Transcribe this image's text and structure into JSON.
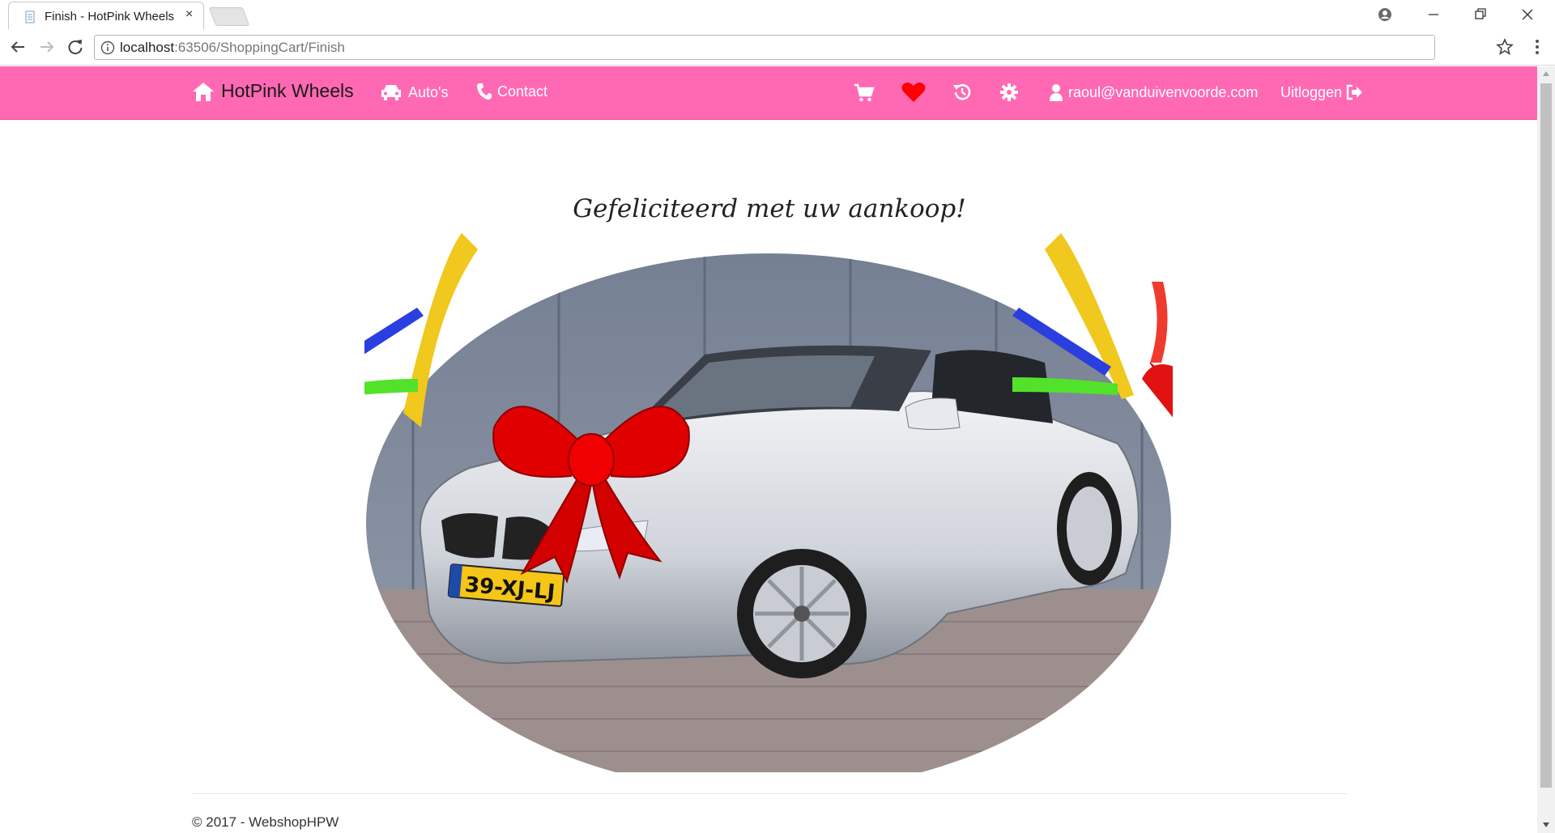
{
  "browser": {
    "tab_title": "Finish - HotPink Wheels",
    "close_glyph": "×",
    "url_host": "localhost",
    "url_path": ":63506/ShoppingCart/Finish"
  },
  "navbar": {
    "brand": "HotPink Wheels",
    "autos_label": "Auto's",
    "contact_label": "Contact",
    "user_email": "raoul@vanduivenvoorde.com",
    "logout_label": "Uitloggen",
    "heart_color": "#ff0000",
    "bar_color": "#ff69b4"
  },
  "main": {
    "headline": "Gefeliciteerd met uw aankoop!",
    "plate": "39-XJ-LJ"
  },
  "footer": {
    "text": "© 2017 - WebshopHPW"
  }
}
